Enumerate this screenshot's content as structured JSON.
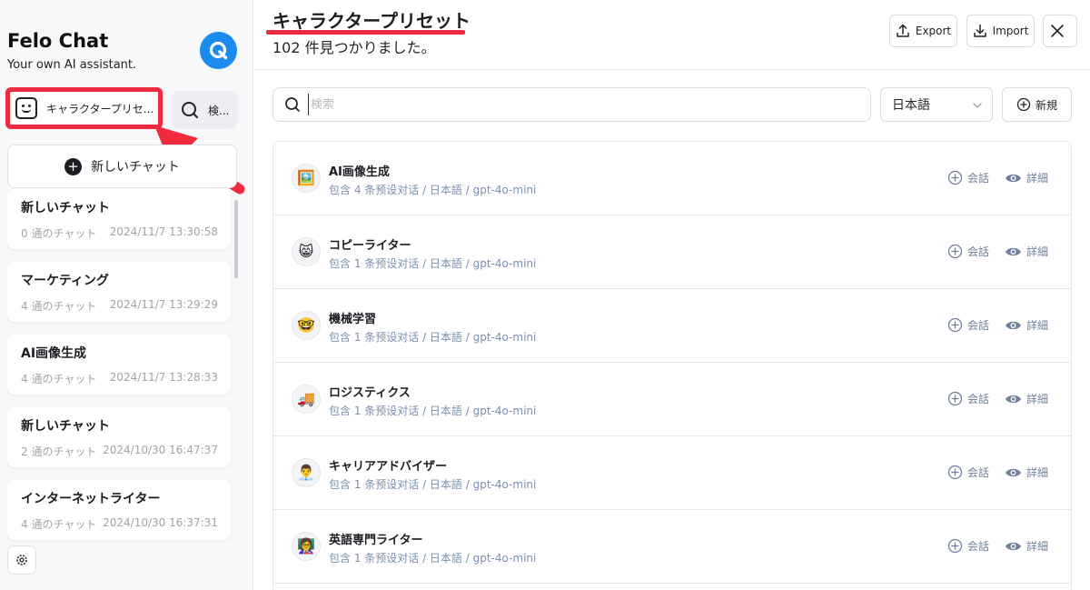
{
  "sidebar": {
    "brand_title": "Felo Chat",
    "brand_subtitle": "Your own AI assistant.",
    "logo_icon": "felo-q-logo",
    "preset_button_label": "キャラクタープリセ...",
    "search_button_label": "検...",
    "new_chat_label": "新しいチャット",
    "chats": [
      {
        "title": "新しいチャット",
        "count": "0 通のチャット",
        "date": "2024/11/7 13:30:58"
      },
      {
        "title": "マーケティング",
        "count": "4 通のチャット",
        "date": "2024/11/7 13:29:29"
      },
      {
        "title": "AI画像生成",
        "count": "4 通のチャット",
        "date": "2024/11/7 13:28:33"
      },
      {
        "title": "新しいチャット",
        "count": "2 通のチャット",
        "date": "2024/10/30 16:47:37"
      },
      {
        "title": "インターネットライター",
        "count": "4 通のチャット",
        "date": "2024/10/30 16:37:31"
      }
    ]
  },
  "header": {
    "title": "キャラクタープリセット",
    "result_count": "102 件見つかりました。",
    "export_label": "Export",
    "import_label": "Import"
  },
  "search": {
    "placeholder": "検索",
    "language_value": "日本語",
    "new_label": "新規"
  },
  "presets": [
    {
      "name": "AI画像生成",
      "meta": "包含 4 条预设对话 / 日本語 / gpt-4o-mini",
      "emoji": "🖼️",
      "chat_label": "会話",
      "detail_label": "詳細"
    },
    {
      "name": "コピーライター",
      "meta": "包含 1 条预设对话 / 日本語 / gpt-4o-mini",
      "emoji": "😸",
      "chat_label": "会話",
      "detail_label": "詳細"
    },
    {
      "name": "機械学習",
      "meta": "包含 1 条预设对话 / 日本語 / gpt-4o-mini",
      "emoji": "🤓",
      "chat_label": "会話",
      "detail_label": "詳細"
    },
    {
      "name": "ロジスティクス",
      "meta": "包含 1 条预设对话 / 日本語 / gpt-4o-mini",
      "emoji": "🚚",
      "chat_label": "会話",
      "detail_label": "詳細"
    },
    {
      "name": "キャリアアドバイザー",
      "meta": "包含 1 条预设对话 / 日本語 / gpt-4o-mini",
      "emoji": "👨‍💼",
      "chat_label": "会話",
      "detail_label": "詳細"
    },
    {
      "name": "英語専門ライター",
      "meta": "包含 1 条预设对话 / 日本語 / gpt-4o-mini",
      "emoji": "👩‍🏫",
      "chat_label": "会話",
      "detail_label": "詳細"
    }
  ],
  "colors": {
    "accent_red": "#ef2b3f",
    "brand_blue": "#1b8bf0",
    "meta_text": "#7b8fb0"
  }
}
